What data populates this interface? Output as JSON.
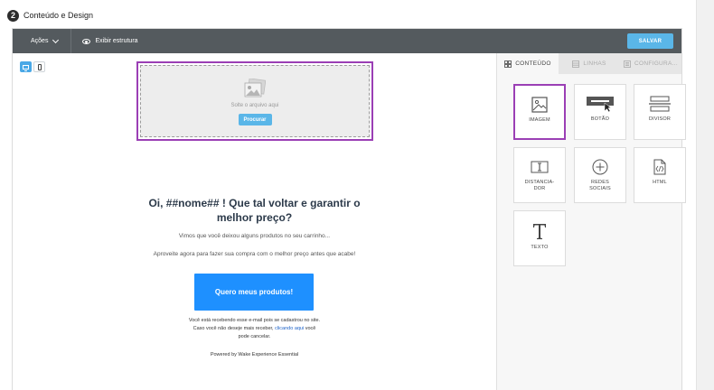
{
  "step": {
    "number": "2",
    "title": "Conteúdo e Design"
  },
  "toolbar": {
    "actions_label": "Ações",
    "structure_label": "Exibir estrutura",
    "save_label": "SALVAR"
  },
  "canvas": {
    "dropzone": {
      "text": "Solte o arquivo aqui",
      "button": "Procurar"
    },
    "headline": "Oi, ##nome## ! Que tal voltar e garantir o melhor preço?",
    "paragraph1": "Vimos que você deixou alguns produtos no seu carrinho...",
    "paragraph2": "Aproveite agora para fazer sua compra com o melhor preço antes que acabe!",
    "cta": "Quero meus produtos!",
    "footer": {
      "line1": "Você está recebendo esse e-mail pois se cadastrou no site.",
      "line2_pre": "Caso você não deseje mais receber, ",
      "line2_link": "clicando aqui",
      "line2_post": " você",
      "line3": "pode cancelar.",
      "powered": "Powered by Wake Experience Essential"
    }
  },
  "panel": {
    "tabs": [
      {
        "label": "CONTEÚDO",
        "icon": "grid-icon",
        "active": true
      },
      {
        "label": "LINHAS",
        "icon": "rows-icon",
        "active": false
      },
      {
        "label": "CONFIGURA...",
        "icon": "settings-icon",
        "active": false
      }
    ],
    "blocks": [
      {
        "label": "IMAGEM",
        "icon": "image-icon"
      },
      {
        "label": "BOTÃO",
        "icon": "button-icon"
      },
      {
        "label": "DIVISOR",
        "icon": "divider-icon"
      },
      {
        "label": "DISTANCIA-",
        "label2": "DOR",
        "icon": "spacer-icon"
      },
      {
        "label": "REDES",
        "label2": "SOCIAIS",
        "icon": "social-icon"
      },
      {
        "label": "HTML",
        "icon": "html-icon"
      },
      {
        "label": "TEXTO",
        "icon": "text-icon"
      }
    ]
  },
  "colors": {
    "accent": "#5ab6e8",
    "selection": "#9b3fb5",
    "toolbar": "#545a5e",
    "cta": "#1e90ff"
  }
}
